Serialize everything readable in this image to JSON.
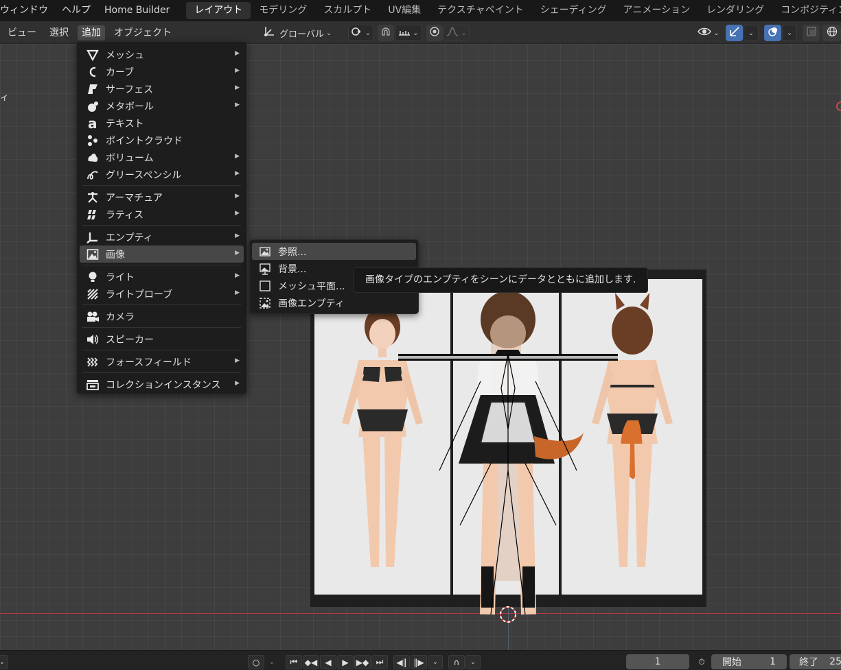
{
  "topbar": {
    "menus": [
      "ウィンドウ",
      "ヘルプ",
      "Home Builder"
    ],
    "workspaces": [
      "レイアウト",
      "モデリング",
      "スカルプト",
      "UV編集",
      "テクスチャペイント",
      "シェーディング",
      "アニメーション",
      "レンダリング",
      "コンポジティン"
    ],
    "active_workspace": "レイアウト"
  },
  "header": {
    "menus": [
      "ビュー",
      "選択",
      "追加",
      "オブジェクト"
    ],
    "active_menu": "追加",
    "transform_orientation": "グローバル"
  },
  "viewport": {
    "left_clipped_text": "ィ"
  },
  "add_menu": {
    "groups": [
      [
        {
          "label": "メッシュ",
          "icon": "mesh-icon",
          "submenu": true
        },
        {
          "label": "カーブ",
          "icon": "curve-icon",
          "submenu": true
        },
        {
          "label": "サーフェス",
          "icon": "surface-icon",
          "submenu": true
        },
        {
          "label": "メタボール",
          "icon": "metaball-icon",
          "submenu": true
        },
        {
          "label": "テキスト",
          "icon": "text-icon",
          "submenu": false
        },
        {
          "label": "ポイントクラウド",
          "icon": "pointcloud-icon",
          "submenu": false
        },
        {
          "label": "ボリューム",
          "icon": "volume-icon",
          "submenu": true
        },
        {
          "label": "グリースペンシル",
          "icon": "grease-pencil-icon",
          "submenu": true
        }
      ],
      [
        {
          "label": "アーマチュア",
          "icon": "armature-icon",
          "submenu": true
        },
        {
          "label": "ラティス",
          "icon": "lattice-icon",
          "submenu": true
        }
      ],
      [
        {
          "label": "エンプティ",
          "icon": "empty-icon",
          "submenu": true
        },
        {
          "label": "画像",
          "icon": "image-icon",
          "submenu": true,
          "highlighted": true
        }
      ],
      [
        {
          "label": "ライト",
          "icon": "light-icon",
          "submenu": true
        },
        {
          "label": "ライトプローブ",
          "icon": "lightprobe-icon",
          "submenu": true
        }
      ],
      [
        {
          "label": "カメラ",
          "icon": "camera-icon",
          "submenu": false
        }
      ],
      [
        {
          "label": "スピーカー",
          "icon": "speaker-icon",
          "submenu": false
        }
      ],
      [
        {
          "label": "フォースフィールド",
          "icon": "forcefield-icon",
          "submenu": true
        }
      ],
      [
        {
          "label": "コレクションインスタンス",
          "icon": "collection-instance-icon",
          "submenu": true
        }
      ]
    ]
  },
  "image_submenu": {
    "items": [
      {
        "label": "参照...",
        "icon": "image-reference-icon",
        "highlighted": true
      },
      {
        "label": "背景...",
        "icon": "image-background-icon"
      },
      {
        "label": "メッシュ平面...",
        "icon": "mesh-plane-icon"
      },
      {
        "label": "画像エンプティ",
        "icon": "image-empty-icon"
      }
    ]
  },
  "tooltip": {
    "text": "画像タイプのエンプティをシーンにデータとともに追加します."
  },
  "timeline": {
    "current_frame": "1",
    "start_label": "開始",
    "start_value": "1",
    "end_label": "終了",
    "end_value": "25"
  },
  "colors": {
    "accent_blue": "#4772b3",
    "menu_bg": "#1d1d1d",
    "highlight": "#474747",
    "x_axis": "#b63a44"
  }
}
